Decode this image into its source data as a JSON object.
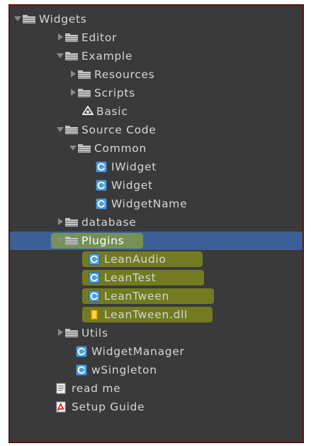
{
  "tree": {
    "widgets": "Widgets",
    "editor": "Editor",
    "example": "Example",
    "resources": "Resources",
    "scripts": "Scripts",
    "basic": "Basic",
    "source_code": "Source Code",
    "common": "Common",
    "iwidget": "IWidget",
    "widget": "Widget",
    "widget_name": "WidgetName",
    "database": "database",
    "plugins": "Plugins",
    "lean_audio": "LeanAudio",
    "lean_test": "LeanTest",
    "lean_tween": "LeanTween",
    "lean_tween_dll": "LeanTween.dll",
    "utils": "Utils",
    "widget_manager": "WidgetManager",
    "w_singleton": "wSingleton",
    "read_me": "read me",
    "setup_guide": "Setup Guide"
  },
  "icons": {
    "folder": "folder-icon",
    "csharp": "csharp-script-icon",
    "dll": "dll-icon",
    "unity_scene": "unity-scene-icon",
    "text": "text-file-icon",
    "pdf": "pdf-icon"
  },
  "colors": {
    "panel_bg": "#3a3a3a",
    "text": "#d6d6d6",
    "selection": "#3d5f97",
    "highlight": "#c4d600",
    "csharp_icon": "#5aa7e6"
  }
}
